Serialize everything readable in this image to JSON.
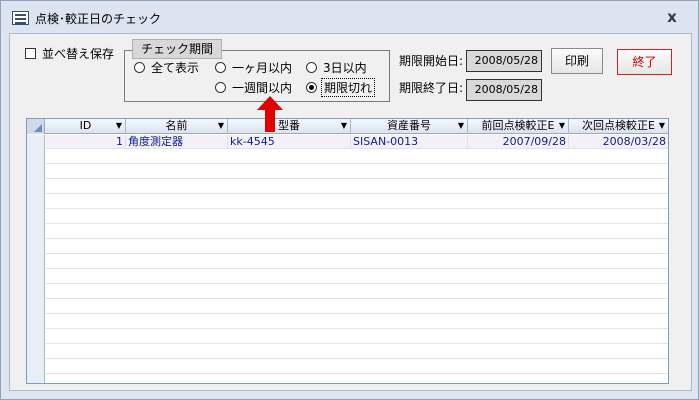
{
  "window": {
    "title": "点検･較正日のチェック",
    "close": "x"
  },
  "form": {
    "sort_save_label": "並べ替え保存",
    "period_group_title": "チェック期間",
    "radios": [
      {
        "label": "全て表示",
        "selected": false
      },
      {
        "label": "一ヶ月以内",
        "selected": false
      },
      {
        "label": "3日以内",
        "selected": false
      },
      {
        "label": "一週間以内",
        "selected": false
      },
      {
        "label": "期限切れ",
        "selected": true
      }
    ],
    "start_label": "期限開始日:",
    "start_value": "2008/05/28",
    "end_label": "期限終了日:",
    "end_value": "2008/05/28",
    "print_button": "印刷",
    "exit_button": "終了"
  },
  "grid": {
    "columns": [
      "ID",
      "名前",
      "型番",
      "資産番号",
      "前回点検較正E",
      "次回点検較正E"
    ],
    "rows": [
      [
        "1",
        "角度測定器",
        "kk-4545",
        "SISAN-0013",
        "2007/09/28",
        "2008/03/28"
      ]
    ]
  },
  "colors": {
    "arrow": "#e00000",
    "exit_text": "#d00000",
    "cell_text": "#0b1f8a"
  }
}
